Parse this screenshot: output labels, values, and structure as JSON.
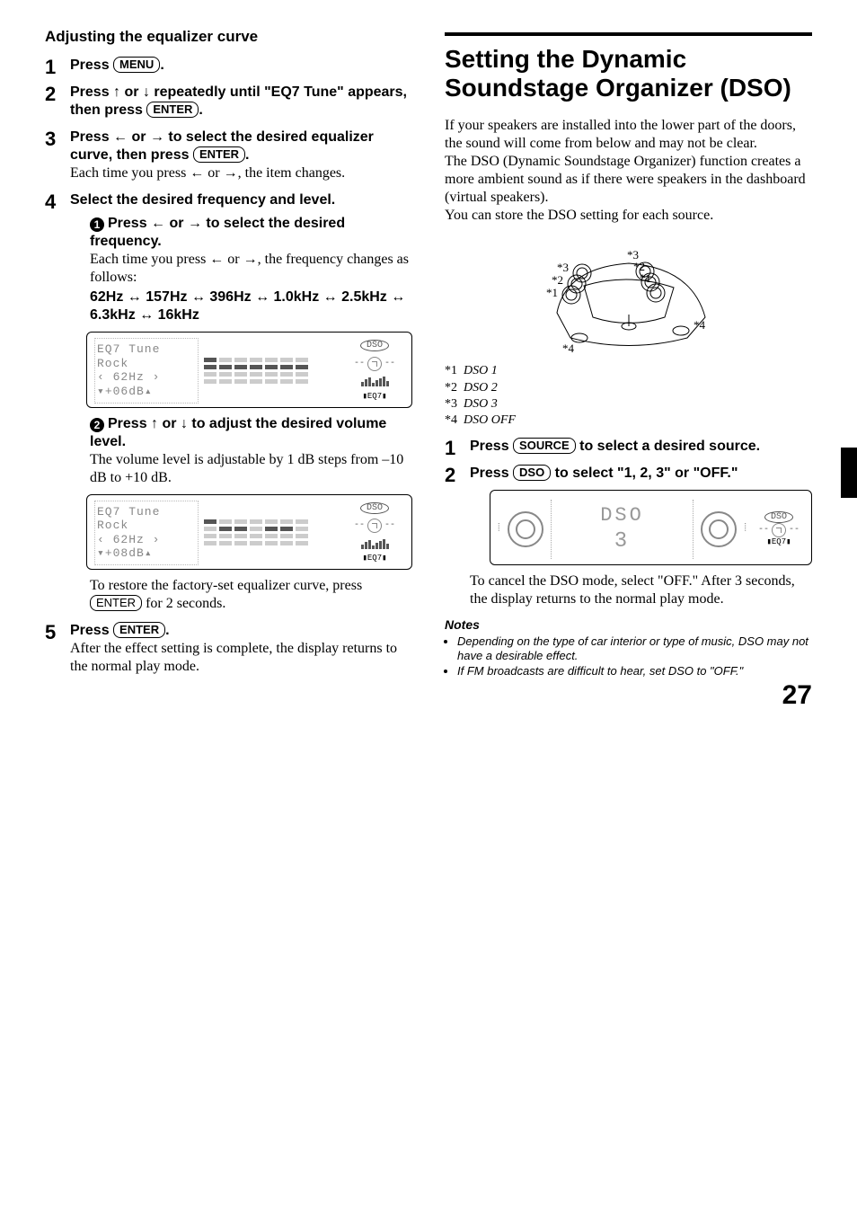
{
  "left": {
    "heading": "Adjusting the equalizer curve",
    "steps": {
      "s1": {
        "press": "Press",
        "btn": "MENU",
        "after": "."
      },
      "s2": {
        "line1a": "Press ",
        "line1b": " or ",
        "line1c": " repeatedly until \"EQ7 Tune\" appears, then press ",
        "btn": "ENTER",
        "after": "."
      },
      "s3": {
        "head1": "Press ",
        "head2": " or ",
        "head3": " to select the desired equalizer curve, then press ",
        "btn": "ENTER",
        "after": ".",
        "body": "Each time you press ",
        "body2": " or ",
        "body3": ", the item changes."
      },
      "s4": {
        "head": "Select the desired frequency and level.",
        "a": {
          "head": "Press ",
          "head2": " or ",
          "head3": " to select the desired frequency.",
          "body": "Each time you press ",
          "body2": " or ",
          "body3": ", the frequency changes as follows:",
          "freq": "62Hz ↔ 157Hz ↔ 396Hz ↔ 1.0kHz ↔ 2.5kHz ↔ 6.3kHz ↔ 16kHz"
        },
        "b": {
          "head": "Press ",
          "head2": " or ",
          "head3": " to adjust the desired volume level.",
          "body": "The volume level is adjustable by 1 dB steps from –10 dB to +10 dB."
        },
        "restore": "To restore the factory-set equalizer curve, press ",
        "restoreBtn": "ENTER",
        "restore2": " for 2 seconds."
      },
      "s5": {
        "head": "Press ",
        "btn": "ENTER",
        "after": ".",
        "body": "After the effect setting is complete, the display returns to the normal play mode."
      }
    },
    "display": {
      "l1": "EQ7 Tune",
      "l2": "Rock",
      "l3a": "‹  62Hz ›",
      "l4a": "▾+06dB▴",
      "l4b": "▾+08dB▴",
      "dso": "DSO",
      "eq7": "EQ7"
    }
  },
  "right": {
    "title": "Setting the Dynamic Soundstage Organizer (DSO)",
    "p1": "If your speakers are installed into the lower part of the doors, the sound will come from below and may not be clear.",
    "p2": "The DSO (Dynamic Soundstage Organizer) function creates a more ambient sound as if there were speakers in the dashboard (virtual speakers).",
    "p3": "You can store the DSO setting for each source.",
    "legend": {
      "l1a": "*1",
      "l1b": "DSO 1",
      "l2a": "*2",
      "l2b": "DSO 2",
      "l3a": "*3",
      "l3b": "DSO 3",
      "l4a": "*4",
      "l4b": "DSO OFF"
    },
    "steps": {
      "s1": {
        "a": "Press ",
        "btn": "SOURCE",
        "b": " to select a desired source."
      },
      "s2": {
        "a": "Press ",
        "btn": "DSO",
        "b": " to select \"1, 2, 3\" or \"OFF.\""
      }
    },
    "dsodisp": {
      "title": "DSO",
      "num": "3",
      "dso": "DSO",
      "eq7": "EQ7"
    },
    "aftercancel": "To cancel the DSO mode, select \"OFF.\" After 3 seconds, the display returns to the normal play mode.",
    "notesHead": "Notes",
    "notes": {
      "n1": "Depending on the type of car interior or type of music, DSO may not have a desirable effect.",
      "n2": "If FM broadcasts are difficult to hear, set DSO to \"OFF.\""
    },
    "diagramLabels": {
      "a": "*1",
      "b": "*2",
      "c": "*3",
      "d": "*4"
    }
  },
  "page": "27",
  "arrows": {
    "up": "↑",
    "down": "↓",
    "left": "←",
    "right": "→",
    "leftB": "←",
    "rightB": "→"
  }
}
